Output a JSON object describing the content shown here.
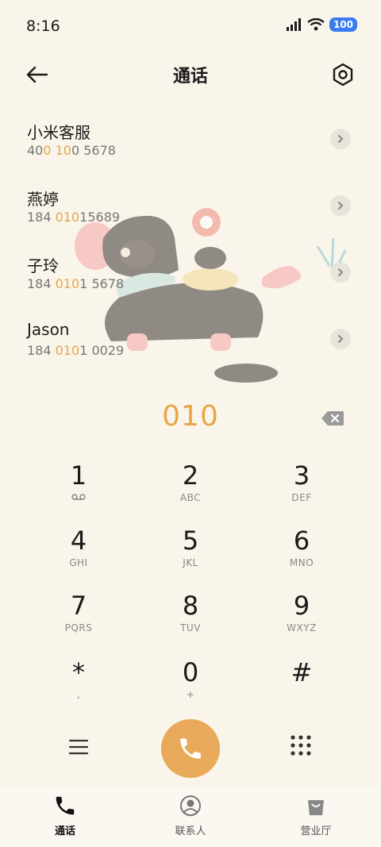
{
  "status_bar": {
    "time": "8:16",
    "battery": "100"
  },
  "header": {
    "title": "通话"
  },
  "contacts": [
    {
      "name": "小米客服",
      "number_parts": [
        "40",
        "0 10",
        "0 5678"
      ]
    },
    {
      "name": "燕婷",
      "number_parts": [
        "184 ",
        "010",
        "15689"
      ]
    },
    {
      "name": "子玲",
      "number_parts": [
        "184 ",
        "010",
        "1 5678"
      ]
    },
    {
      "name": "Jason",
      "number_parts": [
        "184 ",
        "010",
        "1 0029"
      ]
    }
  ],
  "dialer": {
    "input": "010"
  },
  "keypad": [
    {
      "digit": "1",
      "letters": ""
    },
    {
      "digit": "2",
      "letters": "ABC"
    },
    {
      "digit": "3",
      "letters": "DEF"
    },
    {
      "digit": "4",
      "letters": "GHI"
    },
    {
      "digit": "5",
      "letters": "JKL"
    },
    {
      "digit": "6",
      "letters": "MNO"
    },
    {
      "digit": "7",
      "letters": "PQRS"
    },
    {
      "digit": "8",
      "letters": "TUV"
    },
    {
      "digit": "9",
      "letters": "WXYZ"
    },
    {
      "digit": "*",
      "letters": ","
    },
    {
      "digit": "0",
      "letters": "+"
    },
    {
      "digit": "#",
      "letters": ""
    }
  ],
  "bottom_nav": [
    {
      "label": "通话",
      "icon": "phone-icon",
      "active": true
    },
    {
      "label": "联系人",
      "icon": "contact-icon",
      "active": false
    },
    {
      "label": "营业厅",
      "icon": "store-bag-icon",
      "active": false
    }
  ],
  "colors": {
    "accent": "#e8a647",
    "call_button": "#e8aa5a",
    "background": "#faf5ea"
  }
}
